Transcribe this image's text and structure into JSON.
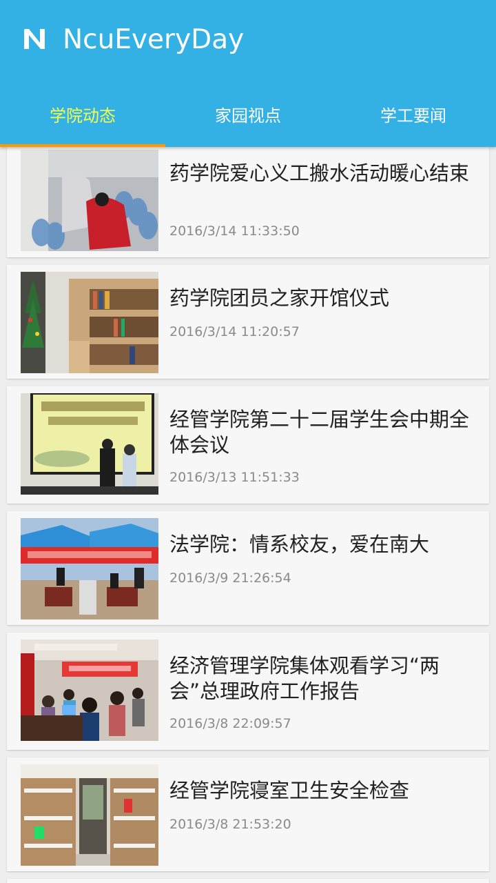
{
  "app": {
    "title": "NcuEveryDay",
    "logo_icon": "n-logo-icon",
    "colors": {
      "toolbar": "#33b1e5",
      "active_tab": "#f6ff4a",
      "indicator": "#ff9800"
    }
  },
  "tabs": [
    {
      "label": "学院动态",
      "active": true
    },
    {
      "label": "家园视点",
      "active": false
    },
    {
      "label": "学工要闻",
      "active": false
    }
  ],
  "news": [
    {
      "title": "药学院爱心义工搬水活动暖心结束",
      "date": "2016/3/14 11:33:50"
    },
    {
      "title": "药学院团员之家开馆仪式",
      "date": "2016/3/14 11:20:57"
    },
    {
      "title": "经管学院第二十二届学生会中期全体会议",
      "date": "2016/3/13 11:51:33"
    },
    {
      "title": "法学院：情系校友，爱在南大",
      "date": "2016/3/9 21:26:54"
    },
    {
      "title": "经济管理学院集体观看学习“两会”总理政府工作报告",
      "date": "2016/3/8 22:09:57"
    },
    {
      "title": "经管学院寝室卫生安全检查",
      "date": "2016/3/8 21:53:20"
    }
  ]
}
